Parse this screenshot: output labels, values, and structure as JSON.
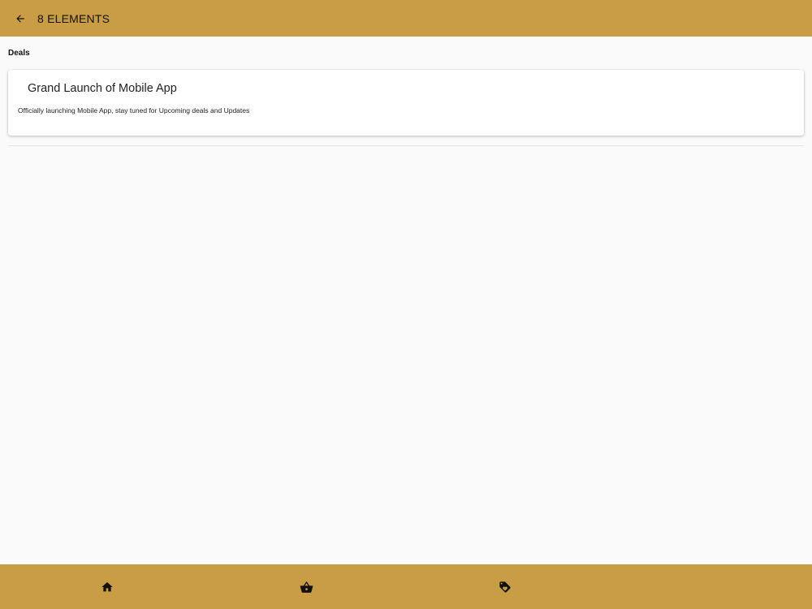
{
  "appbar": {
    "title": "8 ELEMENTS",
    "back_icon": "arrow-left-icon"
  },
  "section": {
    "title": "Deals"
  },
  "deals": [
    {
      "title": "Grand Launch of Mobile App",
      "description": "Officially launching Mobile App, stay tuned for Upcoming deals and Updates"
    }
  ],
  "bottom_nav": [
    {
      "icon": "home-icon"
    },
    {
      "icon": "basket-icon"
    },
    {
      "icon": "tag-icon"
    }
  ],
  "colors": {
    "bar": "#c89d45",
    "background": "#fafafa",
    "card": "#ffffff"
  }
}
